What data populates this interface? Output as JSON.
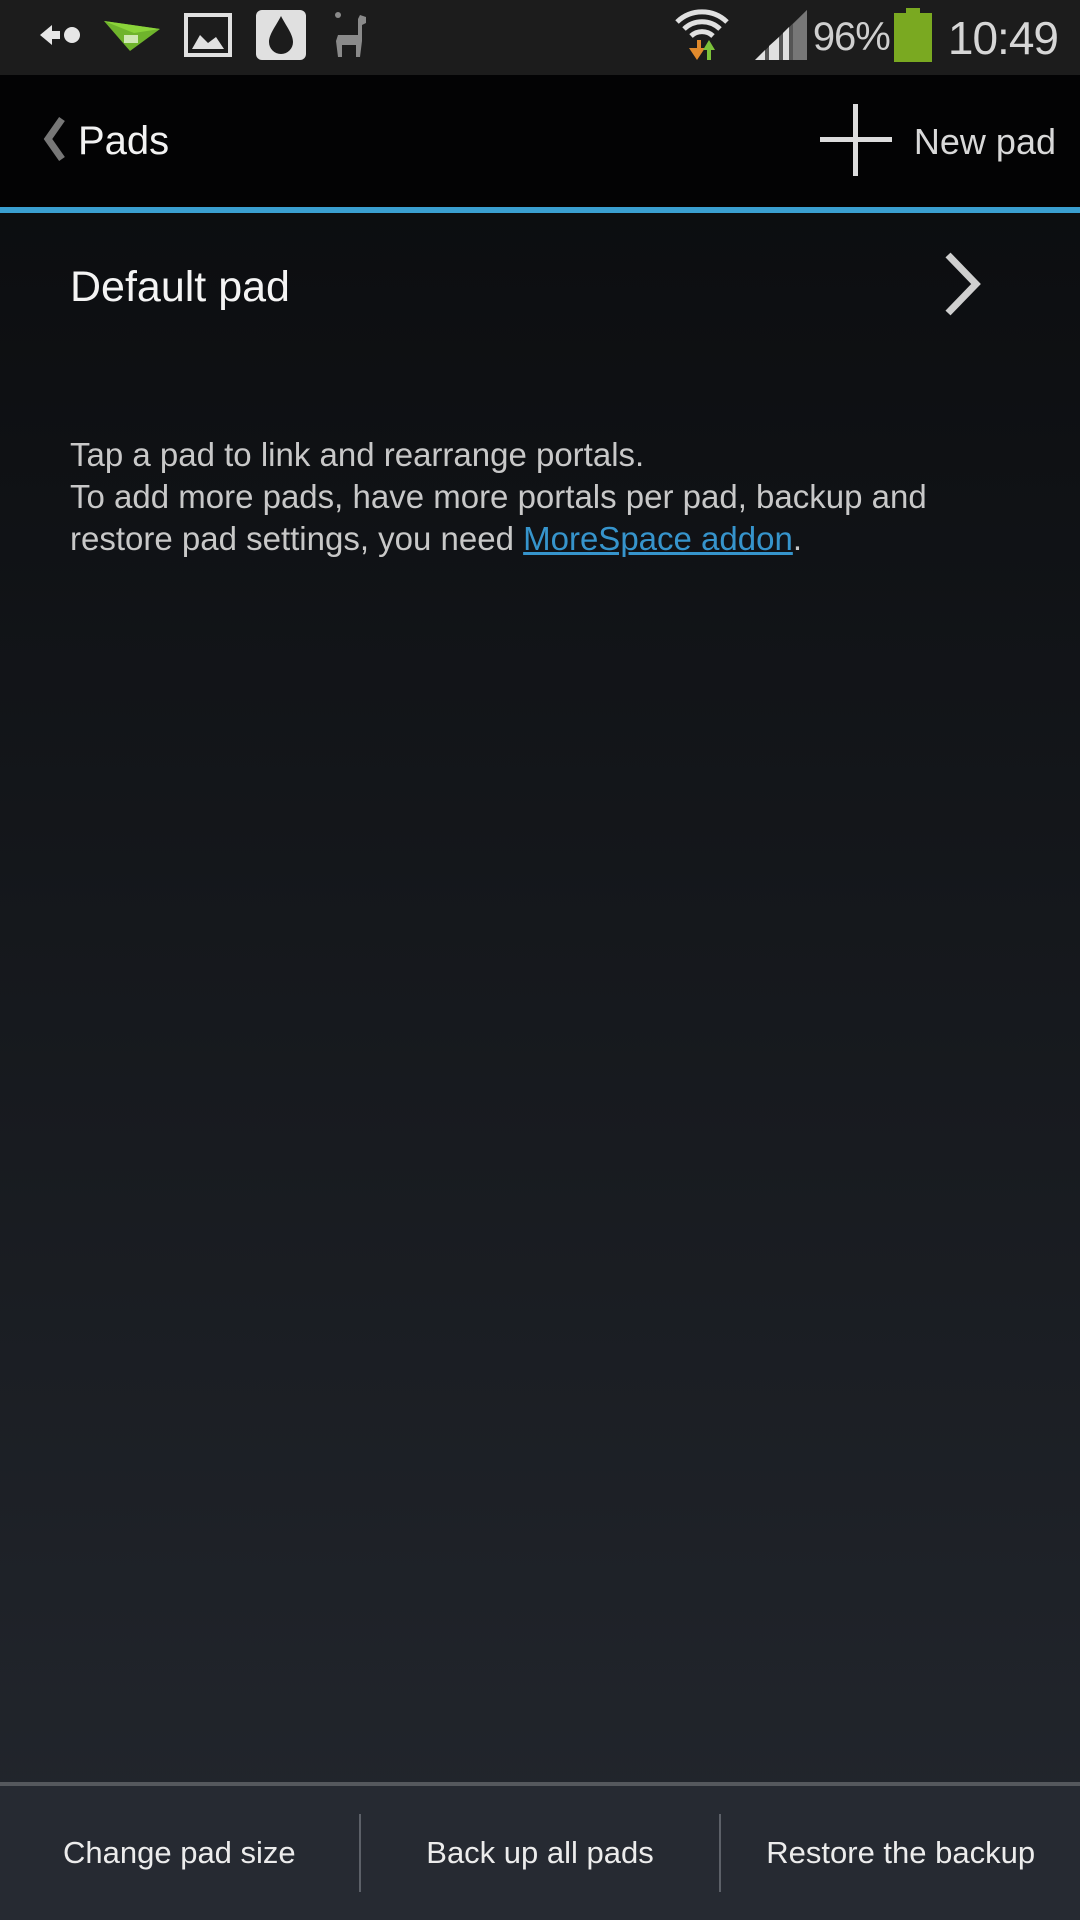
{
  "status_bar": {
    "notification_icons": [
      "call-forward-icon",
      "airdroid-paper-plane-icon",
      "gallery-image-icon",
      "drop-icon",
      "llama-icon"
    ],
    "wifi": "wifi-icon",
    "signal": "signal-icon",
    "battery_percent": "96%",
    "time": "10:49",
    "colors": {
      "battery": "#7aa921",
      "wifi_down": "#e08a2c",
      "wifi_up": "#7cc23a"
    }
  },
  "action_bar": {
    "title": "Pads",
    "new_pad_label": "New pad",
    "accent_color": "#3a9fd0"
  },
  "pads": [
    {
      "name": "Default pad"
    }
  ],
  "info": {
    "line1": "Tap a pad to link and rearrange portals.",
    "line2_prefix": "To add more pads, have more portals per pad, backup and restore pad settings, you need ",
    "link_text": "MoreSpace addon",
    "line2_suffix": ".",
    "link_color": "#3694cc"
  },
  "bottom_bar": {
    "buttons": [
      {
        "label": "Change pad size"
      },
      {
        "label": "Back up all pads"
      },
      {
        "label": "Restore the backup"
      }
    ]
  }
}
